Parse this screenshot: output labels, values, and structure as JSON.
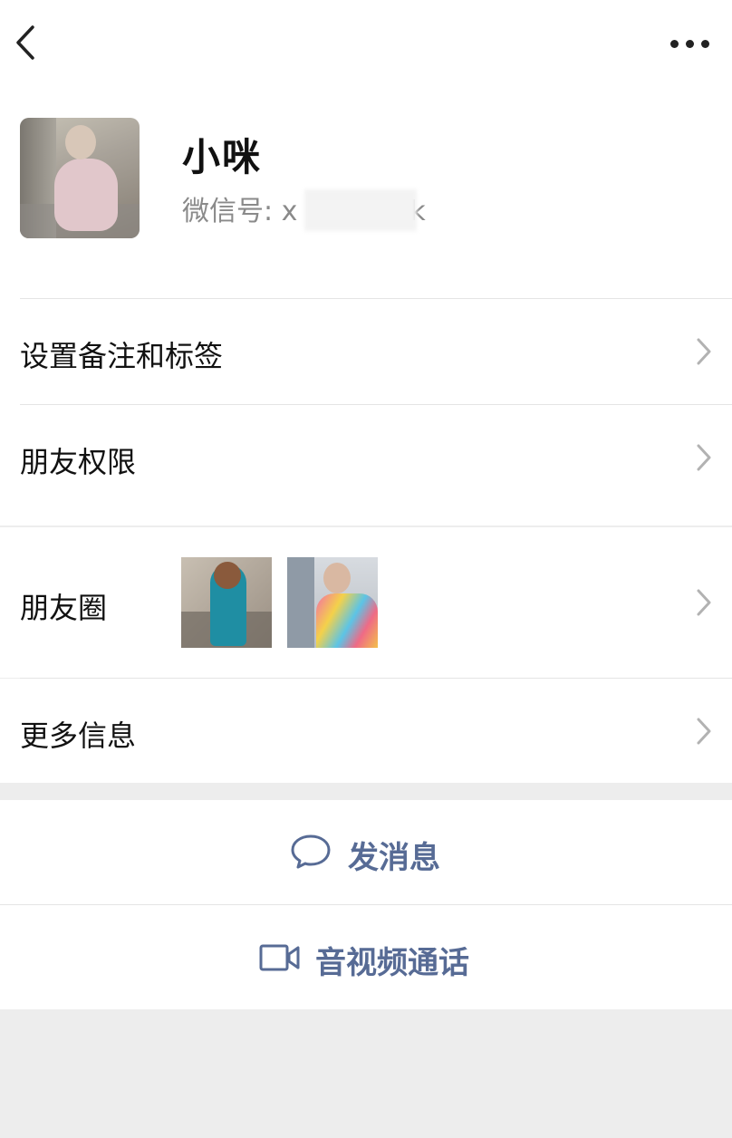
{
  "profile": {
    "name": "小咪",
    "wechat_id_label": "微信号: x",
    "wechat_id_suffix": "k"
  },
  "rows": {
    "remark": "设置备注和标签",
    "permissions": "朋友权限",
    "moments": "朋友圈",
    "more_info": "更多信息"
  },
  "actions": {
    "message": "发消息",
    "call": "音视频通话"
  },
  "colors": {
    "accent": "#576b95",
    "background": "#ededed"
  },
  "icons": {
    "back": "chevron-left-icon",
    "more": "more-dots-icon",
    "chat": "chat-bubble-icon",
    "video": "video-camera-icon"
  }
}
